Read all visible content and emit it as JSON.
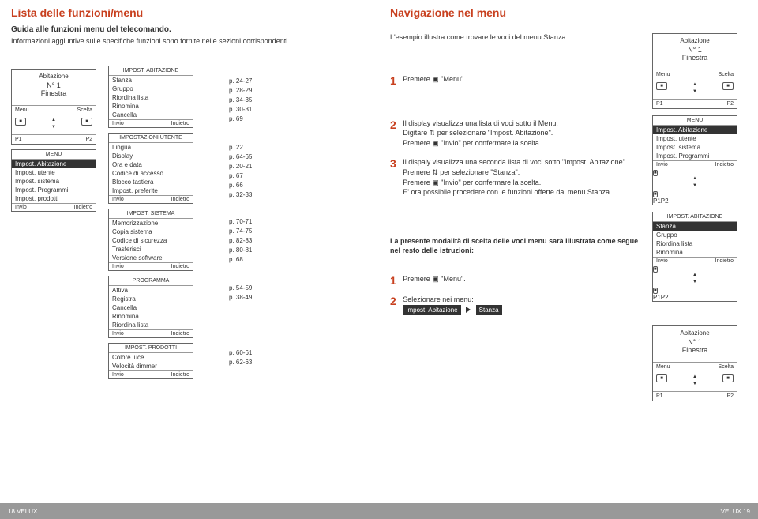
{
  "left": {
    "section_title": "Lista delle funzioni/menu",
    "guide_title": "Guida alle funzioni menu del telecomando.",
    "guide_sub": "Informazioni aggiuntive sulle specifiche funzioni sono fornite nelle sezioni corrispondenti.",
    "remote": {
      "top": "Abitazione",
      "big1": "N° 1",
      "big2": "Finestra",
      "menu_l": "Menu",
      "menu_r": "Scelta",
      "p1": "P1",
      "p2": "P2"
    },
    "main_menu": {
      "title": "MENU",
      "items": [
        "Impost. Abitazione",
        "Impost. utente",
        "Impost. sistema",
        "Impost. Programmi",
        "Impost. prodotti"
      ],
      "fl": "Invio",
      "fr": "Indietro",
      "hl": 0
    },
    "box_abitazione": {
      "title": "IMPOST. ABITAZIONE",
      "items": [
        "Stanza",
        "Gruppo",
        "Riordina lista",
        "Rinomina",
        "Cancella"
      ],
      "fl": "Invio",
      "fr": "Indietro"
    },
    "pages_abitazione": [
      "p. 24-27",
      "p. 28-29",
      "p. 34-35",
      "p. 30-31",
      "p. 69"
    ],
    "box_utente": {
      "title": "IMPOSTAZIONI UTENTE",
      "items": [
        "Lingua",
        "Display",
        "Ora e data",
        "Codice di accesso",
        "Blocco tastiera",
        "Impost. preferite"
      ],
      "fl": "Invio",
      "fr": "Indietro"
    },
    "pages_utente": [
      "p. 22",
      "p. 64-65",
      "p. 20-21",
      "p. 67",
      "p. 66",
      "p. 32-33"
    ],
    "box_sistema": {
      "title": "IMPOST. SISTEMA",
      "items": [
        "Memorizzazione",
        "Copia sistema",
        "Codice di sicurezza",
        "Trasferisci",
        "Versione software"
      ],
      "fl": "Invio",
      "fr": "Indietro"
    },
    "pages_sistema": [
      "p. 70-71",
      "p. 74-75",
      "p. 82-83",
      "p. 80-81",
      "p. 68"
    ],
    "box_programma": {
      "title": "PROGRAMMA",
      "items": [
        "Attiva",
        "Registra",
        "Cancella",
        "Rinomina",
        "Riordina lista"
      ],
      "fl": "Invio",
      "fr": "Indietro"
    },
    "pages_programma": [
      "p. 54-59",
      "p. 38-49"
    ],
    "box_prodotti": {
      "title": "IMPOST. PRODOTTI",
      "items": [
        "Colore luce",
        "Velocità dimmer"
      ],
      "fl": "Invio",
      "fr": "Indietro"
    },
    "pages_prodotti": [
      "p. 60-61",
      "p. 62-63"
    ],
    "footer": "18  VELUX"
  },
  "right": {
    "section_title": "Navigazione nel menu",
    "intro": "L'esempio illustra come trovare le voci del menu Stanza:",
    "step1": "Premere ▣ \"Menu\".",
    "step2a": "Il display visualizza una lista di voci sotto il Menu.",
    "step2b": "Digitare ⇅ per selezionare \"Impost. Abitazione\".",
    "step2c": "Premere ▣ \"Invio\" per confermare la scelta.",
    "step3a": "Il dispaly visualizza una seconda lista di voci sotto \"Impost. Abitazione\".",
    "step3b": "Premere ⇅ per selezionare \"Stanza\".",
    "step3c": "Premere ▣ \"Invio\" per confermare la scelta.",
    "step3d": "E' ora possibile procedere con le funzioni offerte dal menu Stanza.",
    "note_title": "La presente modalità di scelta delle voci menu sarà illustrata come segue nel resto delle istruzioni:",
    "note_step1": "Premere ▣ \"Menu\".",
    "note_step2": "Selezionare nei menu:",
    "chip1": "Impost. Abitazione",
    "chip2": "Stanza",
    "remote1": {
      "top": "Abitazione",
      "big1": "N° 1",
      "big2": "Finestra",
      "menu_l": "Menu",
      "menu_r": "Scelta",
      "p1": "P1",
      "p2": "P2"
    },
    "menu2": {
      "title": "MENU",
      "items": [
        "Impost. Abitazione",
        "Impost. utente",
        "Impost. sistema",
        "Impost. Programmi"
      ],
      "fl": "Invio",
      "fr": "Indietro",
      "hl": 0
    },
    "menu3": {
      "title": "IMPOST. ABITAZIONE",
      "items": [
        "Stanza",
        "Gruppo",
        "Riordina lista",
        "Rinomina"
      ],
      "fl": "Invio",
      "fr": "Indietro",
      "hl": 0
    },
    "remote4": {
      "top": "Abitazione",
      "big1": "N° 1",
      "big2": "Finestra",
      "menu_l": "Menu",
      "menu_r": "Scelta",
      "p1": "P1",
      "p2": "P2"
    },
    "footer": "VELUX  19"
  }
}
